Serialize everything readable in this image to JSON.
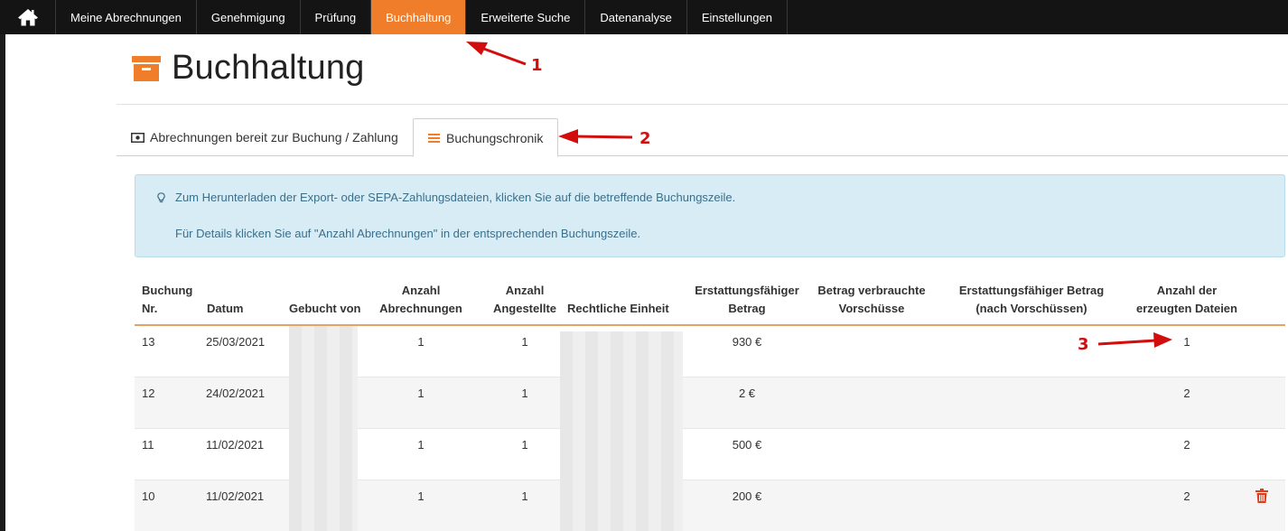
{
  "nav": {
    "items": [
      "Meine Abrechnungen",
      "Genehmigung",
      "Prüfung",
      "Buchhaltung",
      "Erweiterte Suche",
      "Datenanalyse",
      "Einstellungen"
    ],
    "active_index": 3
  },
  "page": {
    "title": "Buchhaltung"
  },
  "tabs": [
    {
      "label": "Abrechnungen bereit zur Buchung / Zahlung"
    },
    {
      "label": "Buchungschronik"
    }
  ],
  "info": {
    "line1": "Zum Herunterladen der Export- oder SEPA-Zahlungsdateien, klicken Sie auf die betreffende Buchungszeile.",
    "line2": "Für Details klicken Sie auf \"Anzahl Abrechnungen\" in der entsprechenden Buchungszeile."
  },
  "table": {
    "headers": [
      [
        "Buchung",
        "Nr."
      ],
      [
        "Datum"
      ],
      [
        "Gebucht von"
      ],
      [
        "Anzahl",
        "Abrechnungen"
      ],
      [
        "Anzahl",
        "Angestellte"
      ],
      [
        "Rechtliche Einheit"
      ],
      [
        "Erstattungsfähiger",
        "Betrag"
      ],
      [
        "Betrag verbrauchte",
        "Vorschüsse"
      ],
      [
        "Erstattungsfähiger Betrag",
        "(nach Vorschüssen)"
      ],
      [
        "Anzahl der",
        "erzeugten Dateien"
      ]
    ],
    "rows": [
      {
        "nr": "13",
        "datum": "25/03/2021",
        "abrechnungen": "1",
        "angestellte": "1",
        "betrag": "930 €",
        "dateien": "1"
      },
      {
        "nr": "12",
        "datum": "24/02/2021",
        "abrechnungen": "1",
        "angestellte": "1",
        "betrag": "2 €",
        "dateien": "2"
      },
      {
        "nr": "11",
        "datum": "11/02/2021",
        "abrechnungen": "1",
        "angestellte": "1",
        "betrag": "500 €",
        "dateien": "2"
      },
      {
        "nr": "10",
        "datum": "11/02/2021",
        "abrechnungen": "1",
        "angestellte": "1",
        "betrag": "200 €",
        "dateien": "2"
      }
    ]
  },
  "annotations": [
    "1",
    "2",
    "3"
  ],
  "colors": {
    "accent": "#f07d2a",
    "annotation": "#d10d0d",
    "info_bg": "#d8ecf5",
    "nav_bg": "#141414"
  }
}
